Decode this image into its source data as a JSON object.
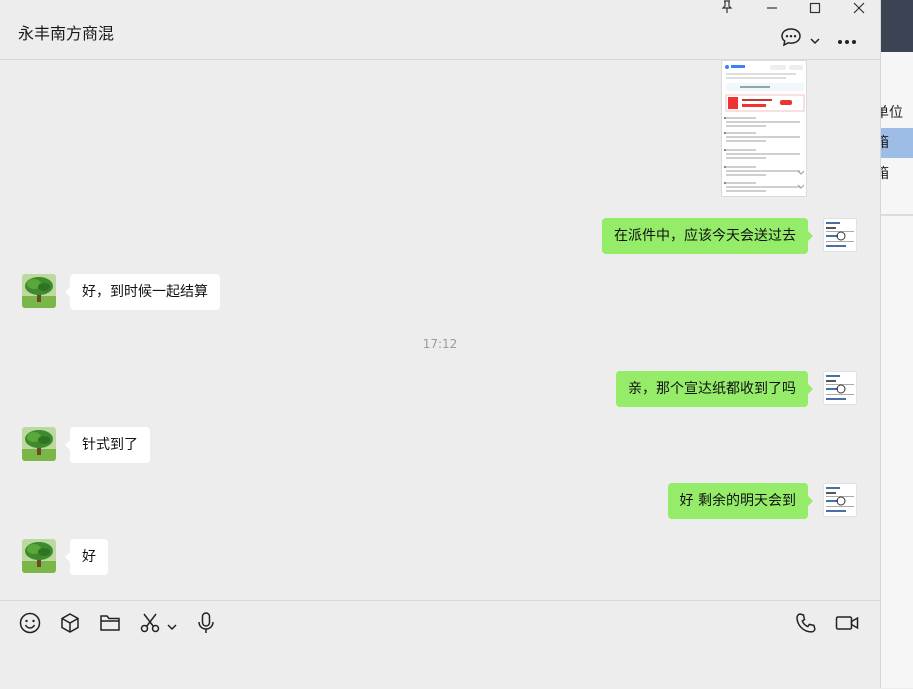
{
  "window": {
    "title": "永丰南方商混",
    "controls": [
      "pin-icon",
      "minimize-icon",
      "maximize-icon",
      "close-icon"
    ]
  },
  "header": {
    "chat_icon": "chat-bubble-icon",
    "dropdown_icon": "chevron-down-icon",
    "more_icon": "more-dots-icon"
  },
  "background_window": {
    "rows": [
      "单位",
      "箱",
      "箱"
    ]
  },
  "messages": [
    {
      "side": "out",
      "type": "image",
      "content": "screenshot-image"
    },
    {
      "side": "out",
      "type": "text",
      "text": "在派件中，应该今天会送过去"
    },
    {
      "side": "in",
      "type": "text",
      "text": "好，到时候一起结算"
    },
    {
      "type": "time",
      "text": "17:12"
    },
    {
      "side": "out",
      "type": "text",
      "text": "亲，那个宣达纸都收到了吗"
    },
    {
      "side": "in",
      "type": "text",
      "text": "针式到了"
    },
    {
      "side": "out",
      "type": "text",
      "text": "好 剩余的明天会到"
    },
    {
      "side": "in",
      "type": "text",
      "text": "好"
    }
  ],
  "toolbar": {
    "left": [
      "emoji-icon",
      "box-icon",
      "folder-icon",
      "scissors-icon",
      "chevron-down-icon",
      "microphone-icon"
    ],
    "right": [
      "phone-icon",
      "video-camera-icon"
    ]
  },
  "colors": {
    "outgoing_bubble": "#95ec69",
    "incoming_bubble": "#ffffff",
    "chat_background": "#ededed",
    "selected_row": "#9ebde6"
  }
}
